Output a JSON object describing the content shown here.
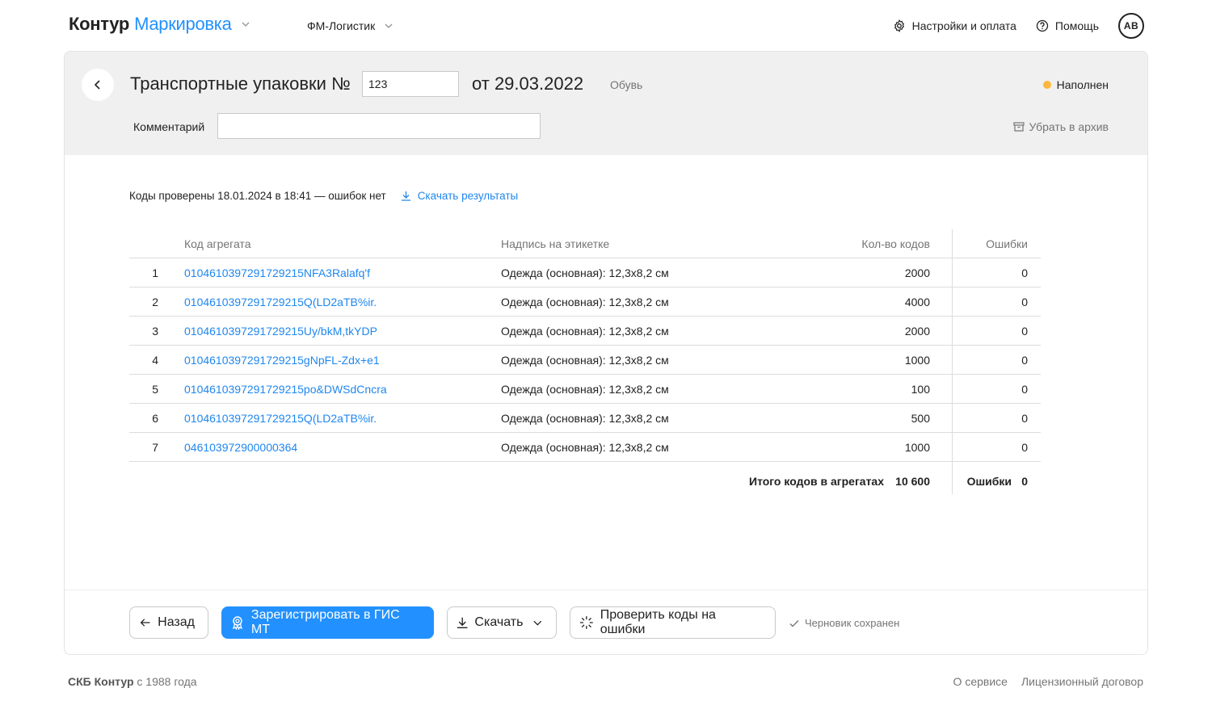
{
  "header": {
    "brand": "Контур",
    "product": "Маркировка",
    "org": "ФМ-Логистик",
    "settings": "Настройки и оплата",
    "help": "Помощь",
    "avatar": "АВ"
  },
  "document": {
    "title": "Транспортные упаковки №",
    "number": "123",
    "date": "от 29.03.2022",
    "category": "Обувь",
    "status": "Наполнен",
    "status_color": "#fcb73e",
    "comment_label": "Комментарий",
    "comment_value": "",
    "archive": "Убрать в архив"
  },
  "check": {
    "text": "Коды проверены 18.01.2024 в 18:41 — ошибок нет",
    "download": "Скачать результаты"
  },
  "table": {
    "headers": {
      "code": "Код агрегата",
      "label": "Надпись на этикетке",
      "qty": "Кол-во кодов",
      "errors": "Ошибки"
    },
    "rows": [
      {
        "idx": "1",
        "code": "0104610397291729215NFA3Ralafq'f",
        "label": "Одежда (основная): 12,3х8,2 см",
        "qty": "2000",
        "errors": "0"
      },
      {
        "idx": "2",
        "code": "0104610397291729215Q(LD2aTB%ir.",
        "label": "Одежда (основная): 12,3х8,2 см",
        "qty": "4000",
        "errors": "0"
      },
      {
        "idx": "3",
        "code": "0104610397291729215Uy/bkM,tkYDP",
        "label": "Одежда (основная): 12,3х8,2 см",
        "qty": "2000",
        "errors": "0"
      },
      {
        "idx": "4",
        "code": "0104610397291729215gNpFL-Zdx+e1",
        "label": "Одежда (основная): 12,3х8,2 см",
        "qty": "1000",
        "errors": "0"
      },
      {
        "idx": "5",
        "code": "0104610397291729215po&DWSdCncra",
        "label": "Одежда (основная): 12,3х8,2 см",
        "qty": "100",
        "errors": "0"
      },
      {
        "idx": "6",
        "code": "0104610397291729215Q(LD2aTB%ir.",
        "label": "Одежда (основная): 12,3х8,2 см",
        "qty": "500",
        "errors": "0"
      },
      {
        "idx": "7",
        "code": "046103972900000364",
        "label": "Одежда (основная): 12,3х8,2 см",
        "qty": "1000",
        "errors": "0"
      }
    ],
    "totals": {
      "label": "Итого кодов в агрегатах",
      "value": "10 600",
      "errors_label": "Ошибки",
      "errors_value": "0"
    }
  },
  "actions": {
    "back": "Назад",
    "register": "Зарегистрировать в ГИС МТ",
    "download": "Скачать",
    "check": "Проверить коды на ошибки",
    "draft": "Черновик сохранен"
  },
  "footer": {
    "company": "СКБ Контур",
    "since": " с 1988 года",
    "about": "О сервисе",
    "license": "Лицензионный договор"
  },
  "colors": {
    "accent": "#2291ff",
    "link": "#1f87ef",
    "header_bg": "#f0f0f0"
  }
}
